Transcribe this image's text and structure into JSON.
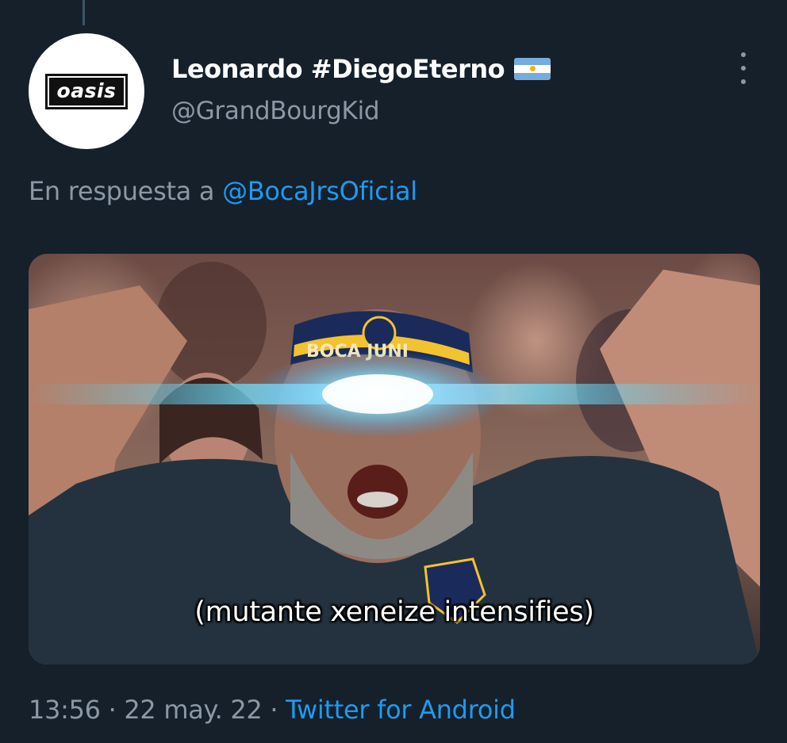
{
  "tweet": {
    "avatar_text": "oasis",
    "display_name": "Leonardo #DiegoEterno",
    "flag_icon": "argentina-flag-icon",
    "handle": "@GrandBourgKid",
    "reply_prefix": "En respuesta a",
    "reply_to": "@BocaJrsOficial",
    "media_caption": "(mutante xeneize intensifies)",
    "headband_text": "BOCA JUNI",
    "time": "13:56",
    "separator": "·",
    "date": "22 may. 22",
    "source": "Twitter for Android"
  },
  "colors": {
    "background": "#15202b",
    "secondary_text": "#8b98a5",
    "link": "#1d9bf0",
    "laser": "#4fd3ff"
  }
}
